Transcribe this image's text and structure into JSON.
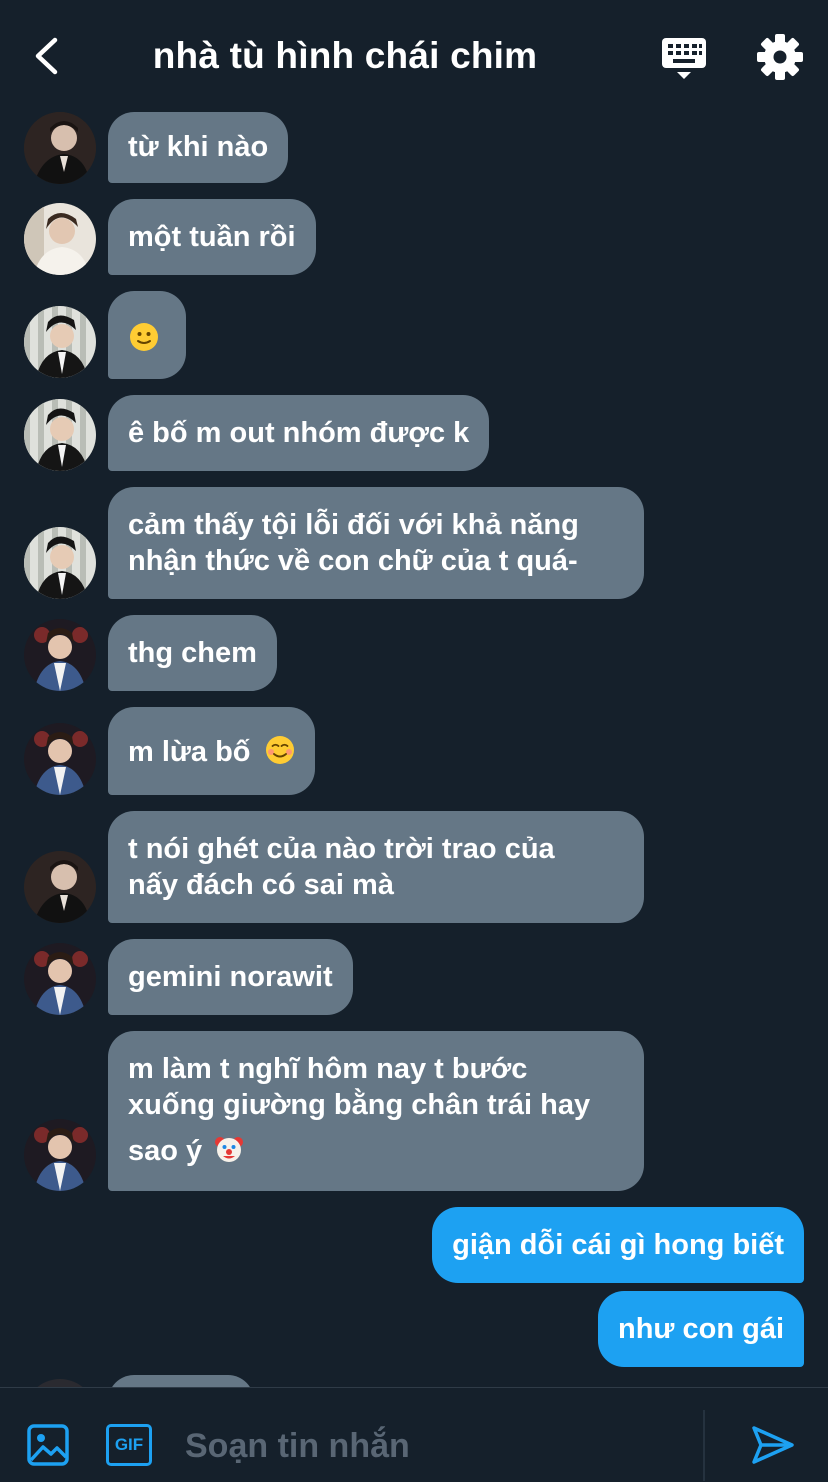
{
  "header": {
    "title": "nhà tù hình chái chim"
  },
  "messages": [
    {
      "sender": "other",
      "avatar": "avatar-dark-suit",
      "text": "từ khi nào"
    },
    {
      "sender": "other",
      "avatar": "avatar-light-sweater",
      "text": "một tuần rồi"
    },
    {
      "sender": "other",
      "avatar": "avatar-striped-bg",
      "emoji": "slightly-smiling-face"
    },
    {
      "sender": "other",
      "avatar": "avatar-striped-bg",
      "text": "ê bố m out nhóm được k"
    },
    {
      "sender": "other",
      "avatar": "avatar-striped-bg",
      "lines": [
        "cảm thấy tội lỗi đối với khả năng",
        "nhận thức về con chữ của t quá-"
      ]
    },
    {
      "sender": "other",
      "avatar": "avatar-denim-jacket",
      "text": "thg chem"
    },
    {
      "sender": "other",
      "avatar": "avatar-denim-jacket",
      "text": "m lừa bố",
      "emoji": "smiling-face"
    },
    {
      "sender": "other",
      "avatar": "avatar-dark-suit",
      "lines": [
        "t nói ghét của nào trời trao của",
        "nấy đách có sai mà"
      ]
    },
    {
      "sender": "other",
      "avatar": "avatar-denim-jacket",
      "text": "gemini norawit"
    },
    {
      "sender": "other",
      "avatar": "avatar-denim-jacket",
      "lines": [
        "m làm t nghĩ hôm nay t bước",
        "xuống giường bằng chân trái hay",
        "sao ý"
      ],
      "emoji": "clown-face"
    },
    {
      "sender": "me",
      "text": "giận dỗi cái gì hong biết"
    },
    {
      "sender": "me",
      "text": "như con gái"
    }
  ],
  "composer": {
    "placeholder": "Soạn tin nhắn",
    "photo_icon": "image-icon",
    "gif_label": "GIF",
    "send_icon": "send-icon"
  },
  "colors": {
    "background": "#15202b",
    "other_bubble": "#657786",
    "my_bubble": "#1da1f2",
    "accent": "#1da1f2"
  }
}
